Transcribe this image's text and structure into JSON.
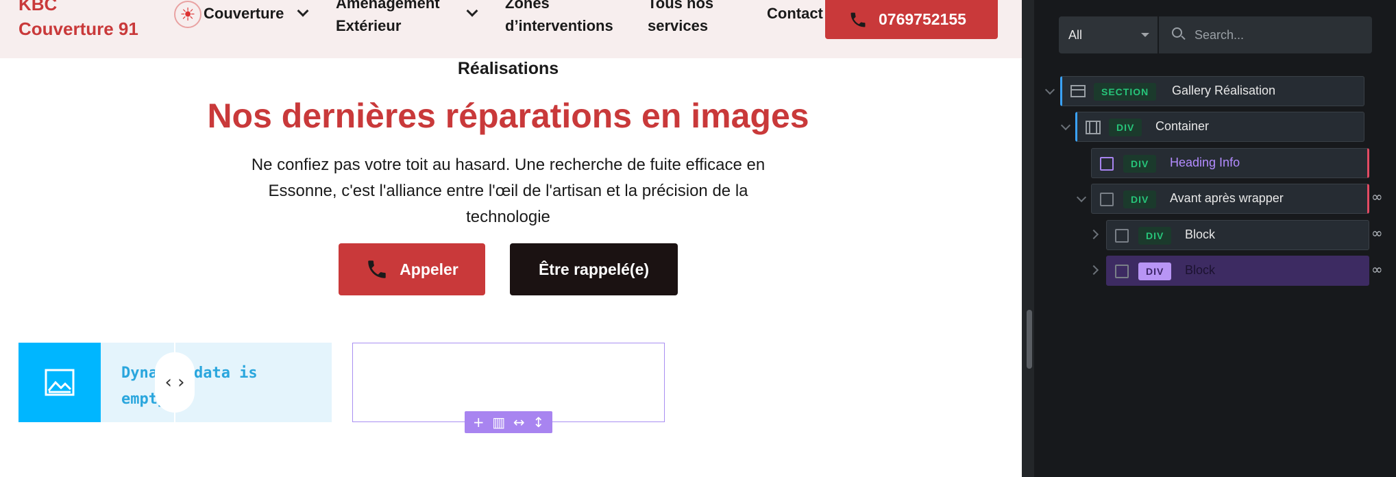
{
  "site": {
    "logo_line1": "KBC",
    "logo_line2": "Couverture 91",
    "nav": [
      {
        "label": "Couverture"
      },
      {
        "label_line1": "Aménagement",
        "label_line2": "Extérieur"
      },
      {
        "label_line1": "Zones",
        "label_line2": "d’interventions"
      },
      {
        "label_line1": "Tous nos",
        "label_line2": "services"
      },
      {
        "label": "Contact"
      }
    ],
    "phone": "0769752155"
  },
  "section": {
    "kicker": "Réalisations",
    "title": "Nos dernières réparations en images",
    "lead": "Ne confiez pas votre toit au hasard. Une recherche de fuite efficace en Essonne, c'est l'alliance entre l'œil de l'artisan et la précision de la technologie",
    "btn_call": "Appeler",
    "btn_callback": "Être rappelé(e)",
    "placeholder_text": "Dynamic data is\nempty",
    "slider_handle": "‹ ›"
  },
  "panel": {
    "filter_value": "All",
    "search_placeholder": "Search...",
    "tree": [
      {
        "tag": "SECTION",
        "label": "Gallery Réalisation"
      },
      {
        "tag": "DIV",
        "label": "Container"
      },
      {
        "tag": "DIV",
        "label": "Heading Info"
      },
      {
        "tag": "DIV",
        "label": "Avant après wrapper"
      },
      {
        "tag": "DIV",
        "label": "Block"
      },
      {
        "tag": "DIV",
        "label": "Block"
      }
    ]
  },
  "colors": {
    "brand_red": "#c9393a",
    "accent_purple": "#a884f0",
    "placeholder_blue": "#00b6ff"
  }
}
